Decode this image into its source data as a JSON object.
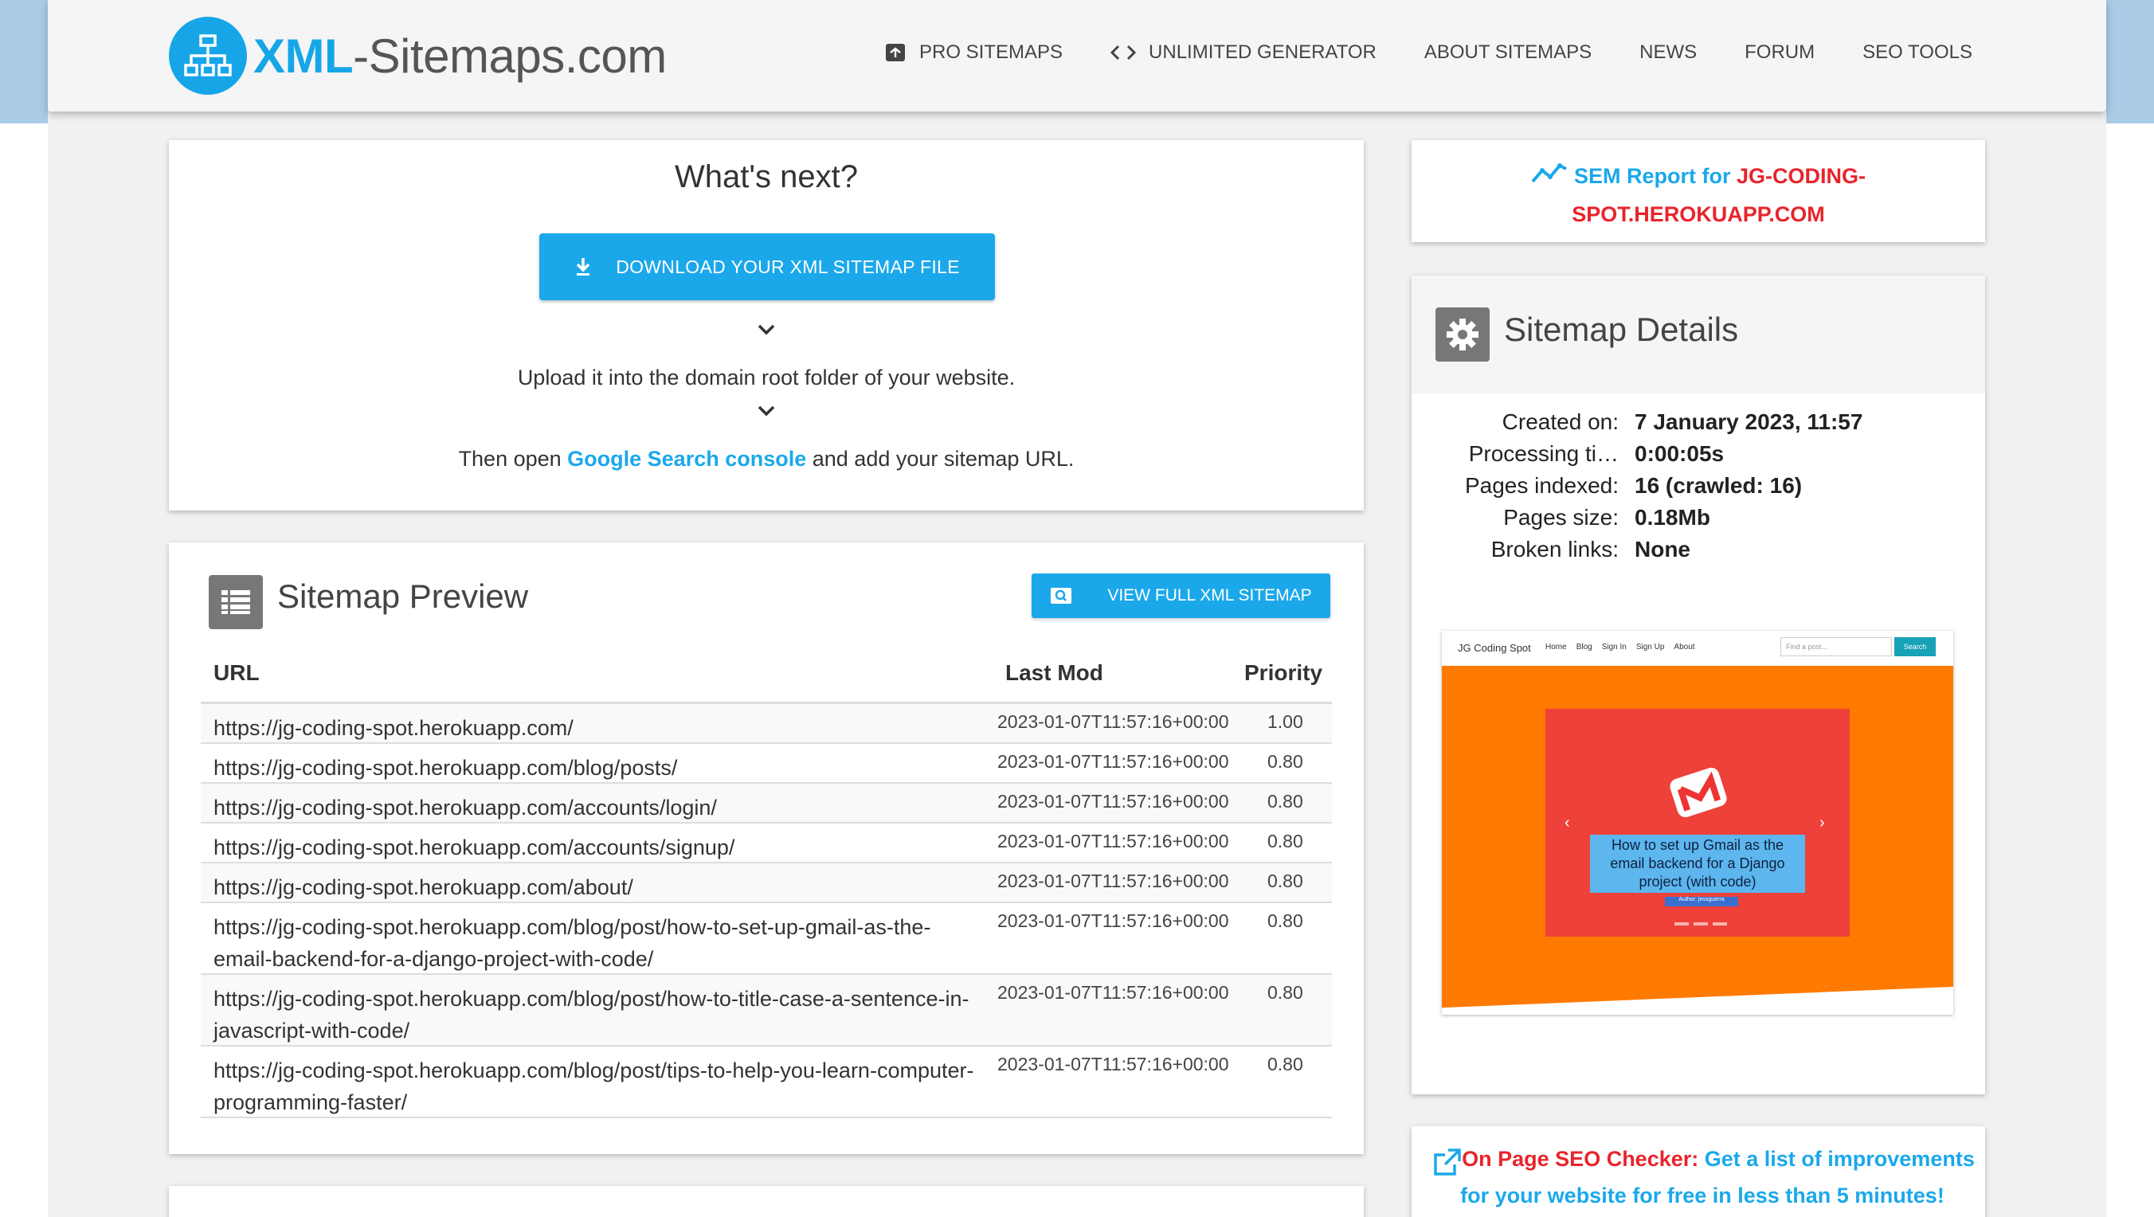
{
  "header": {
    "logo_xml": "XML",
    "logo_rest": "-Sitemaps.com",
    "nav": [
      {
        "label": "PRO SITEMAPS",
        "icon": "archive-icon"
      },
      {
        "label": "UNLIMITED GENERATOR",
        "icon": "code-icon"
      },
      {
        "label": "ABOUT SITEMAPS",
        "icon": ""
      },
      {
        "label": "NEWS",
        "icon": ""
      },
      {
        "label": "FORUM",
        "icon": ""
      },
      {
        "label": "SEO TOOLS",
        "icon": ""
      }
    ]
  },
  "next": {
    "title": "What's next?",
    "download_label": "DOWNLOAD YOUR XML SITEMAP FILE",
    "step1": "Upload it into the domain root folder of your website.",
    "step2_prefix": "Then open ",
    "step2_link": "Google Search console",
    "step2_suffix": " and add your sitemap URL."
  },
  "preview": {
    "title": "Sitemap Preview",
    "view_button": "VIEW FULL XML SITEMAP",
    "columns": {
      "url": "URL",
      "lastmod": "Last Mod",
      "priority": "Priority"
    },
    "rows": [
      {
        "url": "https://jg-coding-spot.herokuapp.com/",
        "lastmod": "2023-01-07T11:57:16+00:00",
        "priority": "1.00"
      },
      {
        "url": "https://jg-coding-spot.herokuapp.com/blog/posts/",
        "lastmod": "2023-01-07T11:57:16+00:00",
        "priority": "0.80"
      },
      {
        "url": "https://jg-coding-spot.herokuapp.com/accounts/login/",
        "lastmod": "2023-01-07T11:57:16+00:00",
        "priority": "0.80"
      },
      {
        "url": "https://jg-coding-spot.herokuapp.com/accounts/signup/",
        "lastmod": "2023-01-07T11:57:16+00:00",
        "priority": "0.80"
      },
      {
        "url": "https://jg-coding-spot.herokuapp.com/about/",
        "lastmod": "2023-01-07T11:57:16+00:00",
        "priority": "0.80"
      },
      {
        "url": "https://jg-coding-spot.herokuapp.com/blog/post/how-to-set-up-gmail-as-the-email-backend-for-a-django-project-with-code/",
        "lastmod": "2023-01-07T11:57:16+00:00",
        "priority": "0.80"
      },
      {
        "url": "https://jg-coding-spot.herokuapp.com/blog/post/how-to-title-case-a-sentence-in-javascript-with-code/",
        "lastmod": "2023-01-07T11:57:16+00:00",
        "priority": "0.80"
      },
      {
        "url": "https://jg-coding-spot.herokuapp.com/blog/post/tips-to-help-you-learn-computer-programming-faster/",
        "lastmod": "2023-01-07T11:57:16+00:00",
        "priority": "0.80"
      }
    ]
  },
  "sem": {
    "label": "SEM Report for ",
    "domain": "JG-CODING-SPOT.HEROKUAPP.COM"
  },
  "details": {
    "title": "Sitemap Details",
    "rows": [
      {
        "label": "Created on:",
        "value": "7 January 2023, 11:57"
      },
      {
        "label": "Processing ti…",
        "value": "0:00:05s"
      },
      {
        "label": "Pages indexed:",
        "value": "16 (crawled: 16)"
      },
      {
        "label": "Pages size:",
        "value": "0.18Mb"
      },
      {
        "label": "Broken links:",
        "value": "None"
      }
    ]
  },
  "thumbnail": {
    "logo": "JG Coding Spot",
    "links": [
      "Home",
      "Blog",
      "Sign In",
      "Sign Up",
      "About"
    ],
    "search_placeholder": "Find a post...",
    "search_button": "Search",
    "caption": "How to set up Gmail as the email backend for a Django project (with code)",
    "author": "Author: jessguerra"
  },
  "seo": {
    "label": "On Page SEO Checker: ",
    "text": "Get a list of improvements for your website for free in less than 5 minutes!"
  },
  "colors": {
    "accent": "#1ba8ea",
    "danger": "#e8242b",
    "hero": "#ff7a00"
  }
}
